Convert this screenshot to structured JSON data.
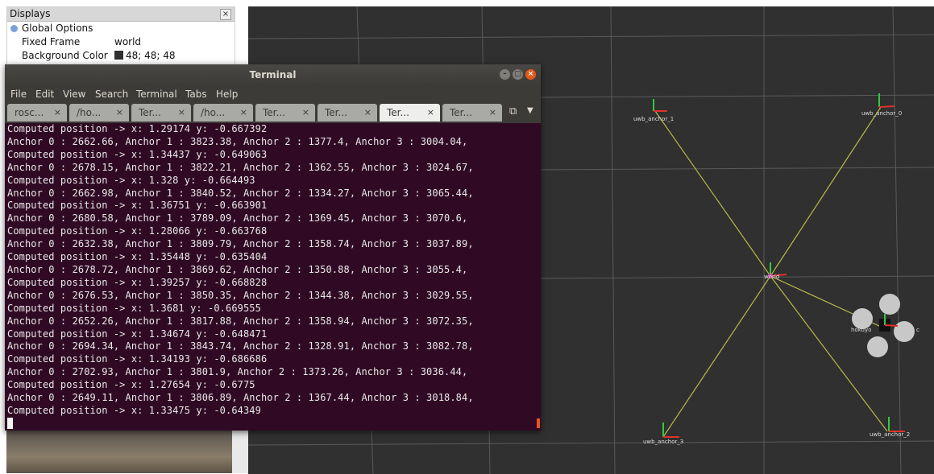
{
  "displays_panel": {
    "title": "Displays",
    "close_glyph": "×",
    "rows": [
      {
        "key": "Global Options",
        "value": ""
      },
      {
        "key": "Fixed Frame",
        "value": "world"
      },
      {
        "key": "Background Color",
        "value": "48; 48; 48"
      }
    ],
    "background_color_hex": "#303030"
  },
  "terminal": {
    "title": "Terminal",
    "menu": [
      "File",
      "Edit",
      "View",
      "Search",
      "Terminal",
      "Tabs",
      "Help"
    ],
    "tabs": [
      {
        "label": "rosc...",
        "active": false
      },
      {
        "label": "/ho...",
        "active": false
      },
      {
        "label": "Ter...",
        "active": false
      },
      {
        "label": "/ho...",
        "active": false
      },
      {
        "label": "Ter...",
        "active": false
      },
      {
        "label": "Ter...",
        "active": false
      },
      {
        "label": "Ter...",
        "active": true
      },
      {
        "label": "Ter...",
        "active": false
      }
    ],
    "tab_close_glyph": "×",
    "new_tab_icon": "new-tab-icon",
    "tabs_menu_icon": "chevron-down-icon",
    "lines": [
      "Computed position -> x: 1.29174 y: -0.667392",
      "Anchor 0 : 2662.66, Anchor 1 : 3823.38, Anchor 2 : 1377.4, Anchor 3 : 3004.04,",
      "Computed position -> x: 1.34437 y: -0.649063",
      "Anchor 0 : 2678.15, Anchor 1 : 3822.21, Anchor 2 : 1362.55, Anchor 3 : 3024.67,",
      "Computed position -> x: 1.328 y: -0.664493",
      "Anchor 0 : 2662.98, Anchor 1 : 3840.52, Anchor 2 : 1334.27, Anchor 3 : 3065.44,",
      "Computed position -> x: 1.36751 y: -0.663901",
      "Anchor 0 : 2680.58, Anchor 1 : 3789.09, Anchor 2 : 1369.45, Anchor 3 : 3070.6,",
      "Computed position -> x: 1.28066 y: -0.663768",
      "Anchor 0 : 2632.38, Anchor 1 : 3809.79, Anchor 2 : 1358.74, Anchor 3 : 3037.89,",
      "Computed position -> x: 1.35448 y: -0.635404",
      "Anchor 0 : 2678.72, Anchor 1 : 3869.62, Anchor 2 : 1350.88, Anchor 3 : 3055.4,",
      "Computed position -> x: 1.39257 y: -0.668828",
      "Anchor 0 : 2676.53, Anchor 1 : 3850.35, Anchor 2 : 1344.38, Anchor 3 : 3029.55,",
      "Computed position -> x: 1.3681 y: -0.669555",
      "Anchor 0 : 2652.26, Anchor 1 : 3817.88, Anchor 2 : 1358.94, Anchor 3 : 3072.35,",
      "Computed position -> x: 1.34674 y: -0.648471",
      "Anchor 0 : 2694.34, Anchor 1 : 3843.74, Anchor 2 : 1328.91, Anchor 3 : 3082.78,",
      "Computed position -> x: 1.34193 y: -0.686686",
      "Anchor 0 : 2702.93, Anchor 1 : 3801.9, Anchor 2 : 1373.26, Anchor 3 : 3036.44,",
      "Computed position -> x: 1.27654 y: -0.6775",
      "Anchor 0 : 2649.11, Anchor 1 : 3806.89, Anchor 2 : 1367.44, Anchor 3 : 3018.84,",
      "Computed position -> x: 1.33475 y: -0.64349"
    ],
    "colors": {
      "background": "#300a24",
      "titlebar": "#3c3b37",
      "close_button": "#e25a1a"
    }
  },
  "viewport": {
    "background": "#303030",
    "grid_color": "#5a5a5a",
    "anchor_line_color": "#b8b84a",
    "labels": {
      "anchor_1": "uwb_anchor_1",
      "anchor_0": "uwb_anchor_0",
      "anchor_2": "uwb_anchor_2",
      "anchor_3": "uwb_anchor_3",
      "origin": "world",
      "drone_left": "hokuyo",
      "drone_right": "c"
    }
  }
}
